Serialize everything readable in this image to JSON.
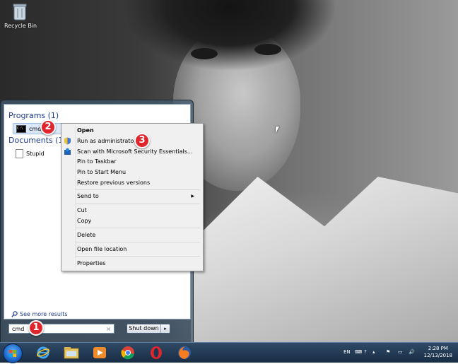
{
  "desktop": {
    "recycle_bin_label": "Recycle Bin"
  },
  "start_menu": {
    "programs_header": "Programs (1)",
    "programs": [
      {
        "label": "cmd",
        "icon": "cmd-icon"
      }
    ],
    "documents_header": "Documents (1)",
    "documents": [
      {
        "label": "Stupid",
        "icon": "document-icon"
      }
    ],
    "see_more_label": "See more results",
    "search": {
      "value": "cmd",
      "clear_glyph": "×"
    },
    "shutdown_label": "Shut down",
    "shutdown_arrow": "▸"
  },
  "context_menu": {
    "items": [
      {
        "label": "Open",
        "bold": true
      },
      {
        "label": "Run as administrator",
        "icon": "uac-shield-icon"
      },
      {
        "label": "Scan with Microsoft Security Essentials...",
        "icon": "security-essentials-icon"
      },
      {
        "label": "Pin to Taskbar"
      },
      {
        "label": "Pin to Start Menu"
      },
      {
        "label": "Restore previous versions"
      },
      {
        "label": "Send to",
        "submenu": true
      },
      {
        "label": "Cut"
      },
      {
        "label": "Copy"
      },
      {
        "label": "Delete"
      },
      {
        "label": "Open file location"
      },
      {
        "label": "Properties"
      }
    ],
    "submenu_arrow": "▶"
  },
  "badges": [
    "1",
    "2",
    "3"
  ],
  "taskbar": {
    "apps": [
      "internet-explorer-icon",
      "file-explorer-icon",
      "media-player-icon",
      "chrome-icon",
      "opera-icon",
      "firefox-icon"
    ],
    "language": "EN",
    "time": "2:28 PM",
    "date": "12/13/2018"
  },
  "colors": {
    "badge": "#e0252c",
    "link": "#1e3c8c",
    "taskbar": "#1f3552"
  }
}
